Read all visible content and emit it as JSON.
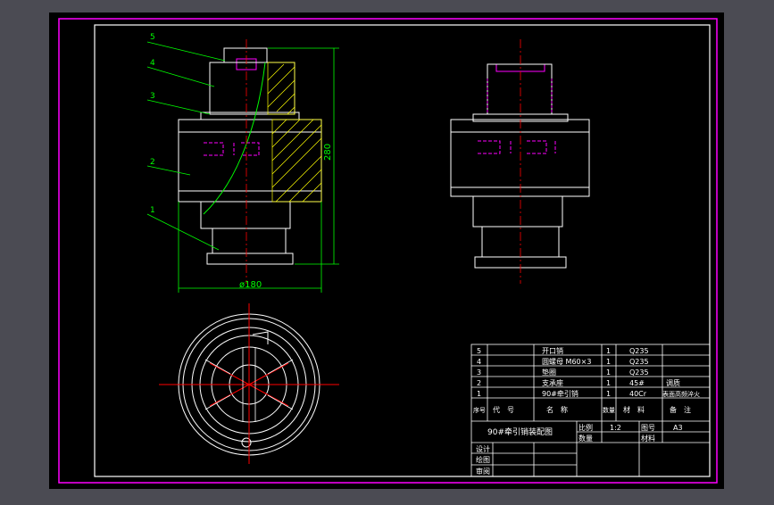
{
  "drawing": {
    "dimensions": {
      "height_label": "280",
      "diameter_label": "ø180"
    },
    "balloons": [
      "5",
      "4",
      "3",
      "2",
      "1"
    ]
  },
  "title_block": {
    "bom_rows": [
      {
        "no": "5",
        "name": "开口销",
        "qty": "1",
        "material": "Q235",
        "note": ""
      },
      {
        "no": "4",
        "name": "圆螺母 M60×3",
        "qty": "1",
        "material": "Q235",
        "note": ""
      },
      {
        "no": "3",
        "name": "垫圈",
        "qty": "1",
        "material": "Q235",
        "note": ""
      },
      {
        "no": "2",
        "name": "支承座",
        "qty": "1",
        "material": "45#",
        "note": "调质"
      },
      {
        "no": "1",
        "name": "90#牵引销",
        "qty": "1",
        "material": "40Cr",
        "note": "表面高频淬火"
      }
    ],
    "header": {
      "no": "序号",
      "code": "代　号",
      "name": "名　称",
      "qty": "数量",
      "material": "材　料",
      "note": "备　注"
    },
    "drawing_name": "90#牵引销装配图",
    "scale_label": "比例",
    "scale_value": "1:2",
    "sheet_label": "图号",
    "sheet_value": "A3",
    "count_label": "数量",
    "material_label": "材料",
    "designed_label": "设计",
    "drawn_label": "绘图",
    "checked_label": "审阅"
  },
  "colors": {
    "background": "#4b4b53",
    "paper": "#000000",
    "border": "#ff00ff",
    "outline": "#ffffff",
    "dimension": "#00ff00",
    "centerline": "#ff0000",
    "hatch": "#ffff00",
    "magenta": "#ff00ff"
  }
}
